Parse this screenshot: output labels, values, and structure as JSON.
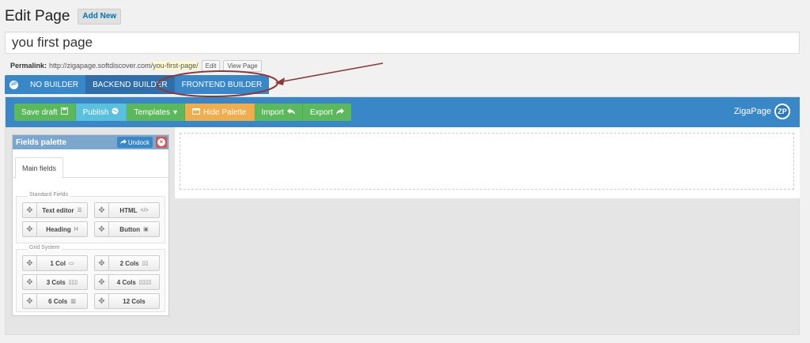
{
  "header": {
    "title": "Edit Page",
    "add_new": "Add New"
  },
  "title_field": {
    "value": "you first page"
  },
  "permalink": {
    "label": "Permalink:",
    "base": "http://zigapage.softdiscover.com/",
    "slug": "you-first-page/",
    "edit": "Edit",
    "view": "View Page"
  },
  "builder_tabs": {
    "logo": "zP",
    "items": [
      "NO BUILDER",
      "BACKEND BUILDER",
      "FRONTEND BUILDER"
    ]
  },
  "toolbar": {
    "save_draft": "Save draft",
    "publish": "Publish",
    "templates": "Templates",
    "hide_palette": "Hide Palette",
    "import": "Import",
    "export": "Export",
    "brand": "ZigaPage",
    "brand_logo": "ZP"
  },
  "palette": {
    "title": "Fields palette",
    "undock": "Undock",
    "tab": "Main fields",
    "standard_legend": "Standard Fields",
    "standard": [
      "Text editor",
      "HTML",
      "Heading",
      "Button"
    ],
    "grid_legend": "Grid System",
    "grid": [
      "1 Col",
      "2 Cols",
      "3 Cols",
      "4 Cols",
      "6 Cols",
      "12 Cols"
    ]
  },
  "colors": {
    "accent": "#3a87c7",
    "success": "#5cb85c",
    "info": "#5bc0de",
    "warning": "#f0ad4e",
    "annotation": "#8b3a3a"
  }
}
